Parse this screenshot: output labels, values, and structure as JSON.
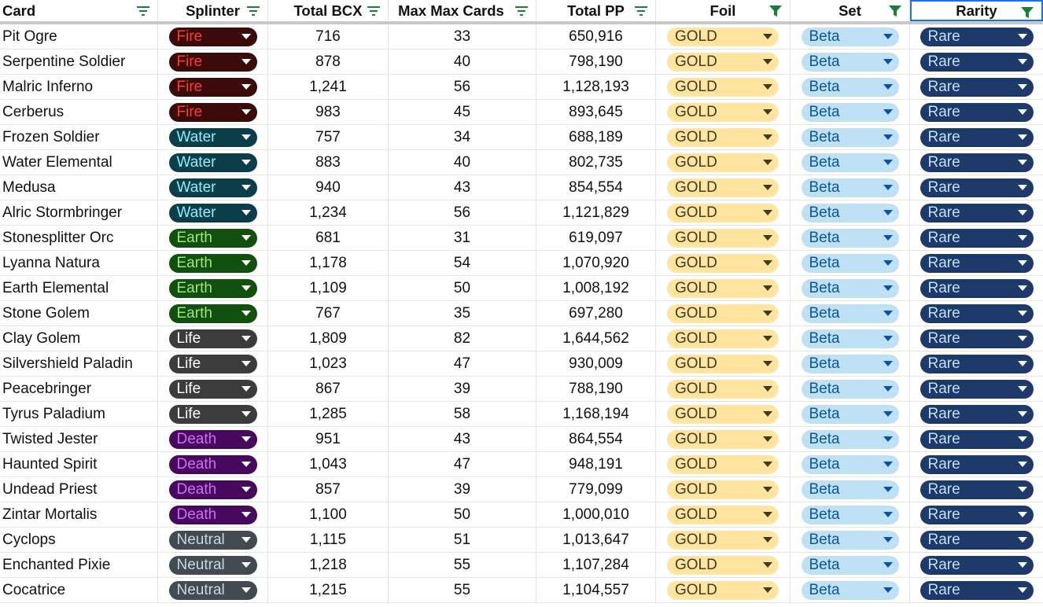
{
  "headers": {
    "card": "Card",
    "splinter": "Splinter",
    "bcx": "Total BCX",
    "max": "Max Max Cards",
    "pp": "Total PP",
    "foil": "Foil",
    "set": "Set",
    "rarity": "Rarity"
  },
  "filter_icons": {
    "inactive": "filter-lines-icon",
    "active": "filter-funnel-icon",
    "inactive_color": "#188038",
    "active_color": "#188038"
  },
  "splinter_styles": {
    "Fire": {
      "bg": "#3b0a0a",
      "fg": "#ff3b30"
    },
    "Water": {
      "bg": "#0b3d4a",
      "fg": "#8ff0f5"
    },
    "Earth": {
      "bg": "#12500f",
      "fg": "#9be878"
    },
    "Life": {
      "bg": "#3c3c3c",
      "fg": "#ffffff"
    },
    "Death": {
      "bg": "#46095e",
      "fg": "#d56bf5"
    },
    "Neutral": {
      "bg": "#434a52",
      "fg": "#c9d6e3"
    }
  },
  "rows": [
    {
      "card": "Pit Ogre",
      "splinter": "Fire",
      "bcx": "716",
      "max": "33",
      "pp": "650,916",
      "foil": "GOLD",
      "set": "Beta",
      "rarity": "Rare"
    },
    {
      "card": "Serpentine Soldier",
      "splinter": "Fire",
      "bcx": "878",
      "max": "40",
      "pp": "798,190",
      "foil": "GOLD",
      "set": "Beta",
      "rarity": "Rare"
    },
    {
      "card": "Malric Inferno",
      "splinter": "Fire",
      "bcx": "1,241",
      "max": "56",
      "pp": "1,128,193",
      "foil": "GOLD",
      "set": "Beta",
      "rarity": "Rare"
    },
    {
      "card": "Cerberus",
      "splinter": "Fire",
      "bcx": "983",
      "max": "45",
      "pp": "893,645",
      "foil": "GOLD",
      "set": "Beta",
      "rarity": "Rare"
    },
    {
      "card": "Frozen Soldier",
      "splinter": "Water",
      "bcx": "757",
      "max": "34",
      "pp": "688,189",
      "foil": "GOLD",
      "set": "Beta",
      "rarity": "Rare"
    },
    {
      "card": "Water Elemental",
      "splinter": "Water",
      "bcx": "883",
      "max": "40",
      "pp": "802,735",
      "foil": "GOLD",
      "set": "Beta",
      "rarity": "Rare"
    },
    {
      "card": "Medusa",
      "splinter": "Water",
      "bcx": "940",
      "max": "43",
      "pp": "854,554",
      "foil": "GOLD",
      "set": "Beta",
      "rarity": "Rare"
    },
    {
      "card": "Alric Stormbringer",
      "splinter": "Water",
      "bcx": "1,234",
      "max": "56",
      "pp": "1,121,829",
      "foil": "GOLD",
      "set": "Beta",
      "rarity": "Rare"
    },
    {
      "card": "Stonesplitter Orc",
      "splinter": "Earth",
      "bcx": "681",
      "max": "31",
      "pp": "619,097",
      "foil": "GOLD",
      "set": "Beta",
      "rarity": "Rare"
    },
    {
      "card": "Lyanna Natura",
      "splinter": "Earth",
      "bcx": "1,178",
      "max": "54",
      "pp": "1,070,920",
      "foil": "GOLD",
      "set": "Beta",
      "rarity": "Rare"
    },
    {
      "card": "Earth Elemental",
      "splinter": "Earth",
      "bcx": "1,109",
      "max": "50",
      "pp": "1,008,192",
      "foil": "GOLD",
      "set": "Beta",
      "rarity": "Rare"
    },
    {
      "card": "Stone Golem",
      "splinter": "Earth",
      "bcx": "767",
      "max": "35",
      "pp": "697,280",
      "foil": "GOLD",
      "set": "Beta",
      "rarity": "Rare"
    },
    {
      "card": "Clay Golem",
      "splinter": "Life",
      "bcx": "1,809",
      "max": "82",
      "pp": "1,644,562",
      "foil": "GOLD",
      "set": "Beta",
      "rarity": "Rare"
    },
    {
      "card": "Silvershield Paladin",
      "splinter": "Life",
      "bcx": "1,023",
      "max": "47",
      "pp": "930,009",
      "foil": "GOLD",
      "set": "Beta",
      "rarity": "Rare"
    },
    {
      "card": "Peacebringer",
      "splinter": "Life",
      "bcx": "867",
      "max": "39",
      "pp": "788,190",
      "foil": "GOLD",
      "set": "Beta",
      "rarity": "Rare"
    },
    {
      "card": "Tyrus Paladium",
      "splinter": "Life",
      "bcx": "1,285",
      "max": "58",
      "pp": "1,168,194",
      "foil": "GOLD",
      "set": "Beta",
      "rarity": "Rare"
    },
    {
      "card": "Twisted Jester",
      "splinter": "Death",
      "bcx": "951",
      "max": "43",
      "pp": "864,554",
      "foil": "GOLD",
      "set": "Beta",
      "rarity": "Rare"
    },
    {
      "card": "Haunted Spirit",
      "splinter": "Death",
      "bcx": "1,043",
      "max": "47",
      "pp": "948,191",
      "foil": "GOLD",
      "set": "Beta",
      "rarity": "Rare"
    },
    {
      "card": "Undead Priest",
      "splinter": "Death",
      "bcx": "857",
      "max": "39",
      "pp": "779,099",
      "foil": "GOLD",
      "set": "Beta",
      "rarity": "Rare"
    },
    {
      "card": "Zintar Mortalis",
      "splinter": "Death",
      "bcx": "1,100",
      "max": "50",
      "pp": "1,000,010",
      "foil": "GOLD",
      "set": "Beta",
      "rarity": "Rare"
    },
    {
      "card": "Cyclops",
      "splinter": "Neutral",
      "bcx": "1,115",
      "max": "51",
      "pp": "1,013,647",
      "foil": "GOLD",
      "set": "Beta",
      "rarity": "Rare"
    },
    {
      "card": "Enchanted Pixie",
      "splinter": "Neutral",
      "bcx": "1,218",
      "max": "55",
      "pp": "1,107,284",
      "foil": "GOLD",
      "set": "Beta",
      "rarity": "Rare"
    },
    {
      "card": "Cocatrice",
      "splinter": "Neutral",
      "bcx": "1,215",
      "max": "55",
      "pp": "1,104,557",
      "foil": "GOLD",
      "set": "Beta",
      "rarity": "Rare"
    }
  ]
}
